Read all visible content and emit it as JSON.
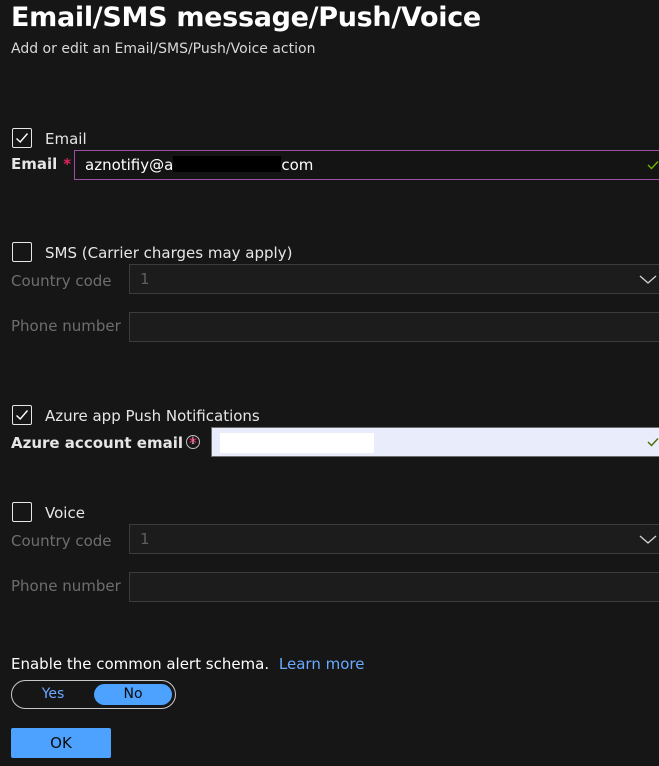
{
  "header": {
    "title": "Email/SMS message/Push/Voice",
    "subtitle": "Add or edit an Email/SMS/Push/Voice action"
  },
  "email": {
    "checkbox_label": "Email",
    "checked": true,
    "field_label": "Email",
    "value_prefix": "aznotifiy@a",
    "value_suffix": "com"
  },
  "sms": {
    "checkbox_label": "SMS (Carrier charges may apply)",
    "checked": false,
    "country_code_label": "Country code",
    "country_code_value": "1",
    "phone_label": "Phone number",
    "phone_value": ""
  },
  "push": {
    "checkbox_label": "Azure app Push Notifications",
    "checked": true,
    "field_label": "Azure account email",
    "info_glyph": "i"
  },
  "voice": {
    "checkbox_label": "Voice",
    "checked": false,
    "country_code_label": "Country code",
    "country_code_value": "1",
    "phone_label": "Phone number",
    "phone_value": ""
  },
  "schema": {
    "label": "Enable the common alert schema.",
    "link": "Learn more",
    "yes_label": "Yes",
    "no_label": "No",
    "selected": "No"
  },
  "footer": {
    "ok_label": "OK"
  },
  "colors": {
    "accent": "#4da2ff",
    "link": "#6aa9ff",
    "required": "#e0245e",
    "email_border": "#9b4fa5",
    "valid_check": "#6bb700"
  }
}
